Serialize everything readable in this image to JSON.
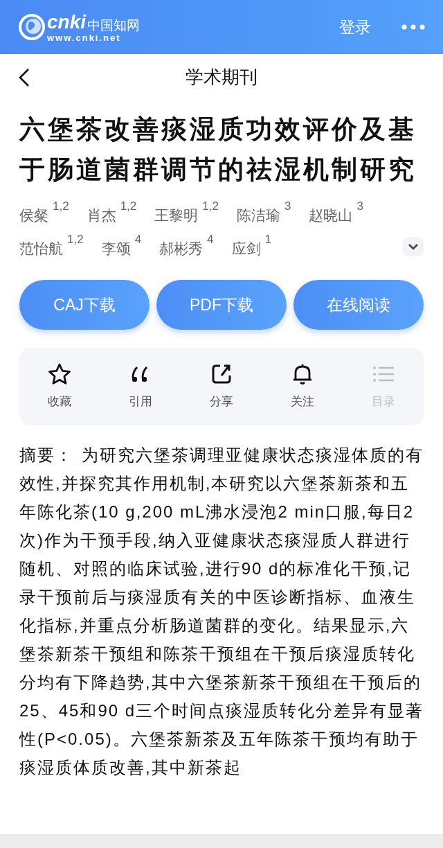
{
  "header": {
    "logo": {
      "mark": "cnki",
      "name": "中国知网",
      "url": "www.cnki.net"
    },
    "login": "登录"
  },
  "nav": {
    "title": "学术期刊"
  },
  "article": {
    "title": "六堡茶改善痰湿质功效评价及基于肠道菌群调节的祛湿机制研究",
    "authors": [
      {
        "name": "侯粲",
        "affil": "1,2"
      },
      {
        "name": "肖杰",
        "affil": "1,2"
      },
      {
        "name": "王黎明",
        "affil": "1,2"
      },
      {
        "name": "陈洁瑜",
        "affil": "3"
      },
      {
        "name": "赵晓山",
        "affil": "3"
      },
      {
        "name": "范怡航",
        "affil": "1,2"
      },
      {
        "name": "李颂",
        "affil": "4"
      },
      {
        "name": "郝彬秀",
        "affil": "4"
      },
      {
        "name": "应剑",
        "affil": "1"
      }
    ],
    "expanded": false
  },
  "buttons": [
    "CAJ下载",
    "PDF下载",
    "在线阅读"
  ],
  "toolbar": [
    {
      "kind": "favorite",
      "label": "收藏",
      "disabled": false
    },
    {
      "kind": "cite",
      "label": "引用",
      "disabled": false
    },
    {
      "kind": "share",
      "label": "分享",
      "disabled": false
    },
    {
      "kind": "follow",
      "label": "关注",
      "disabled": false
    },
    {
      "kind": "toc",
      "label": "目录",
      "disabled": true
    }
  ],
  "abstract": {
    "label": "摘要：",
    "text": "为研究六堡茶调理亚健康状态痰湿体质的有效性,并探究其作用机制,本研究以六堡茶新茶和五年陈化茶(10 g,200 mL沸水浸泡2 min口服,每日2次)作为干预手段,纳入亚健康状态痰湿质人群进行随机、对照的临床试验,进行90 d的标准化干预,记录干预前后与痰湿质有关的中医诊断指标、血液生化指标,并重点分析肠道菌群的变化。结果显示,六堡茶新茶干预组和陈茶干预组在干预后痰湿质转化分均有下降趋势,其中六堡茶新茶干预组在干预后的25、45和90 d三个时间点痰湿质转化分差异有显著性(P<0.05)。六堡茶新茶及五年陈茶干预均有助于痰湿质体质改善,其中新茶起"
  }
}
